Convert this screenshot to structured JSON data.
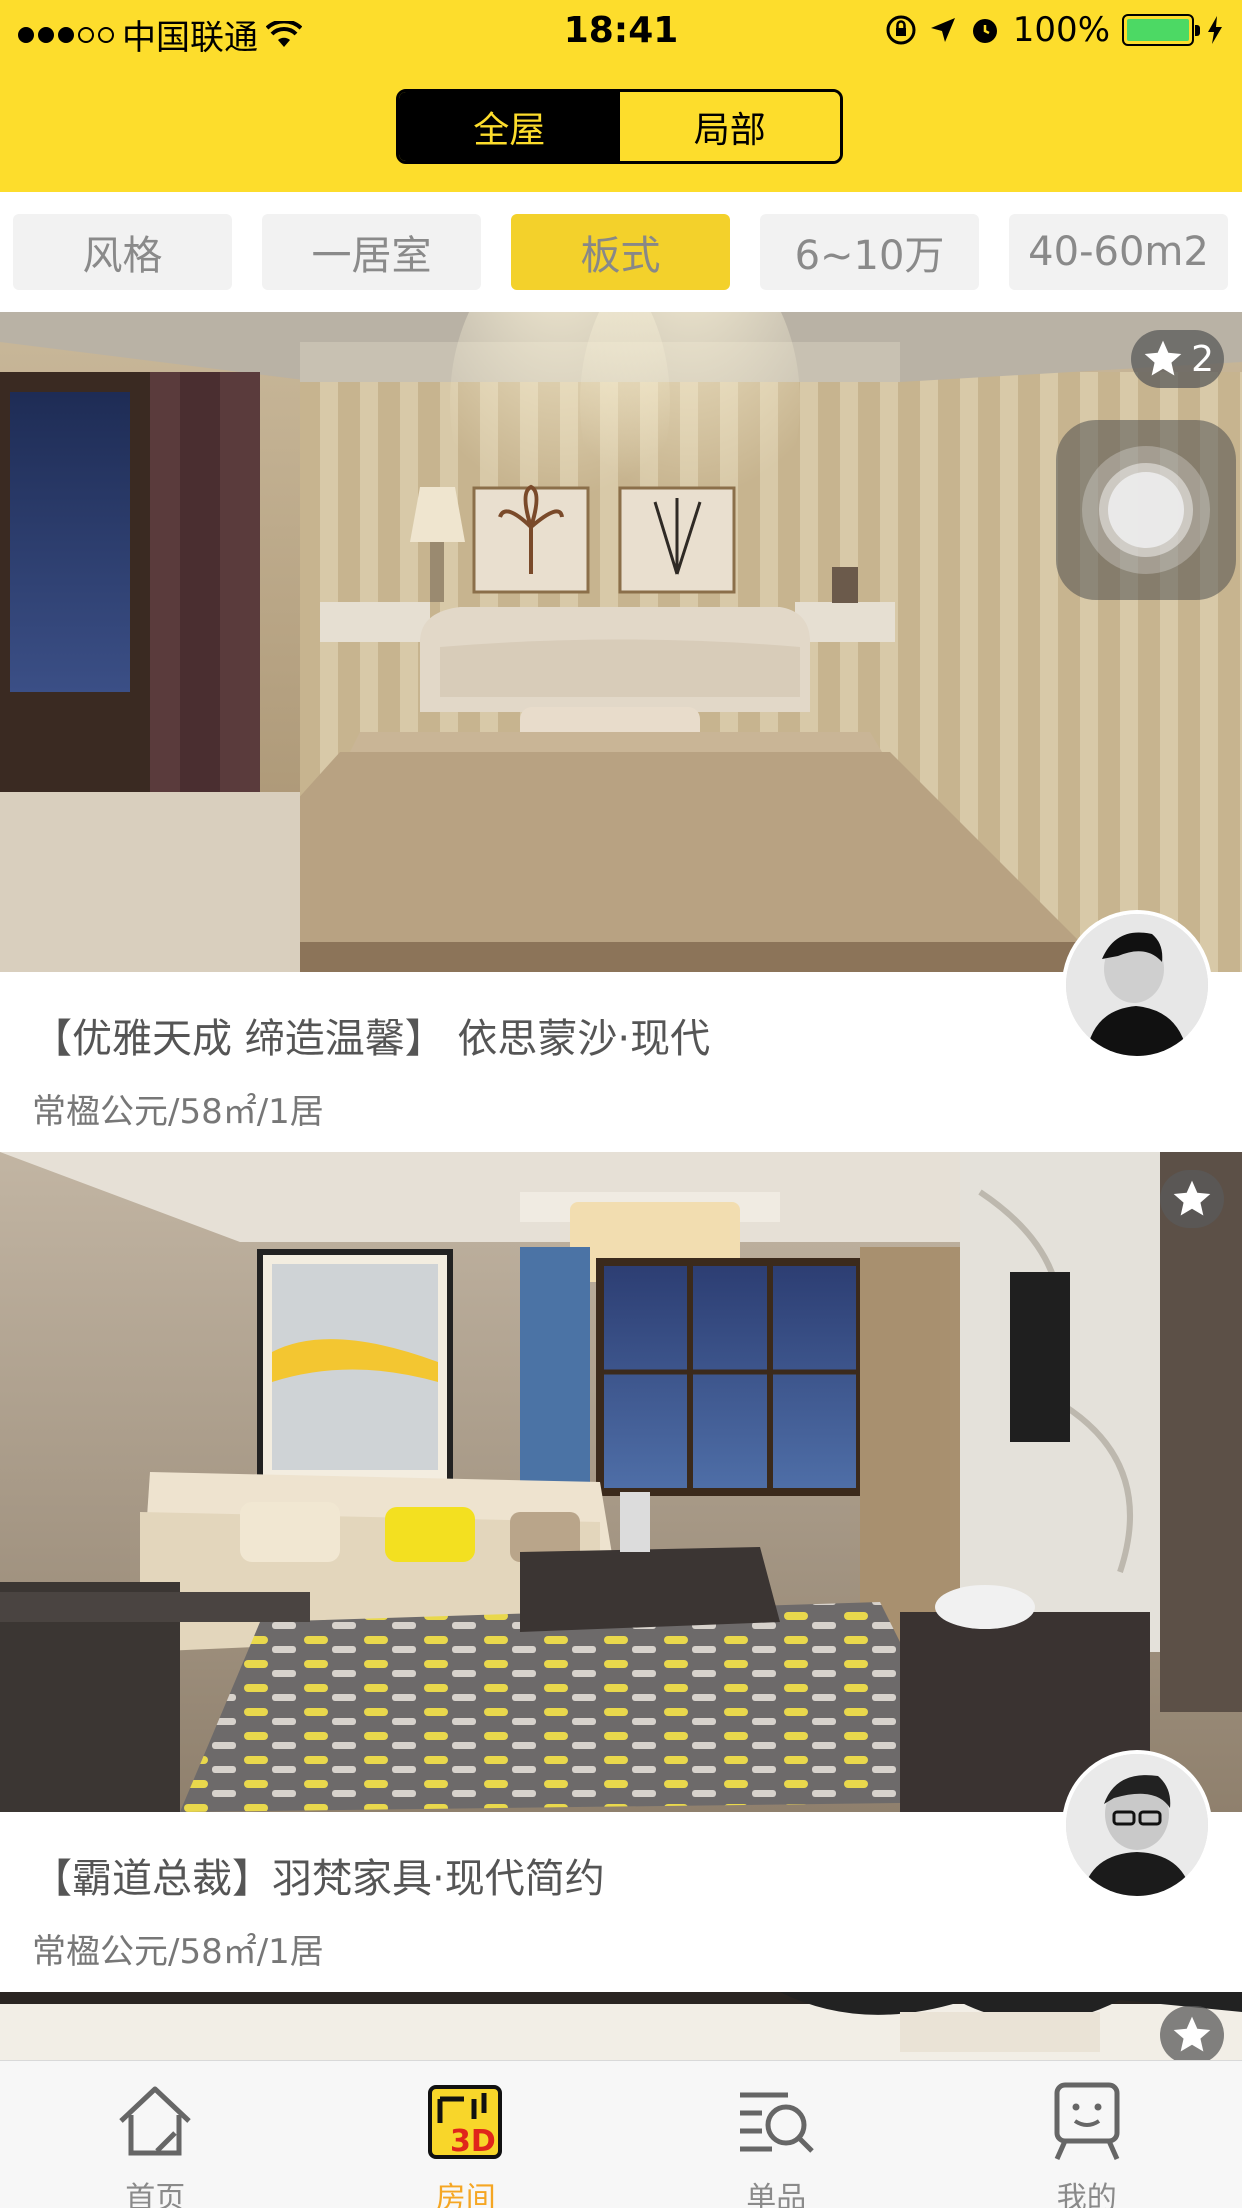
{
  "status_bar": {
    "carrier": "中国联通",
    "time": "18:41",
    "battery": "100%"
  },
  "segment": {
    "active": "全屋",
    "inactive": "局部"
  },
  "filters": [
    "风格",
    "一居室",
    "板式",
    "6~10万",
    "40-60m2"
  ],
  "active_filter_index": 2,
  "cards": [
    {
      "title": "【优雅天成 缔造温馨】 依思蒙沙·现代",
      "subtitle": "常楹公元/58㎡/1居",
      "favorite_count": "2"
    },
    {
      "title": "【霸道总裁】羽梵家具·现代简约",
      "subtitle": "常楹公元/58㎡/1居"
    }
  ],
  "tabbar": {
    "items": [
      {
        "label": "首页",
        "icon": "home-icon"
      },
      {
        "label": "房间",
        "icon": "room-3d-icon"
      },
      {
        "label": "单品",
        "icon": "product-search-icon"
      },
      {
        "label": "我的",
        "icon": "profile-icon"
      }
    ],
    "active_index": 1
  },
  "colors": {
    "accent": "#fddd2c",
    "chip_active": "#f3d12b",
    "tab_active": "#f5a623"
  }
}
